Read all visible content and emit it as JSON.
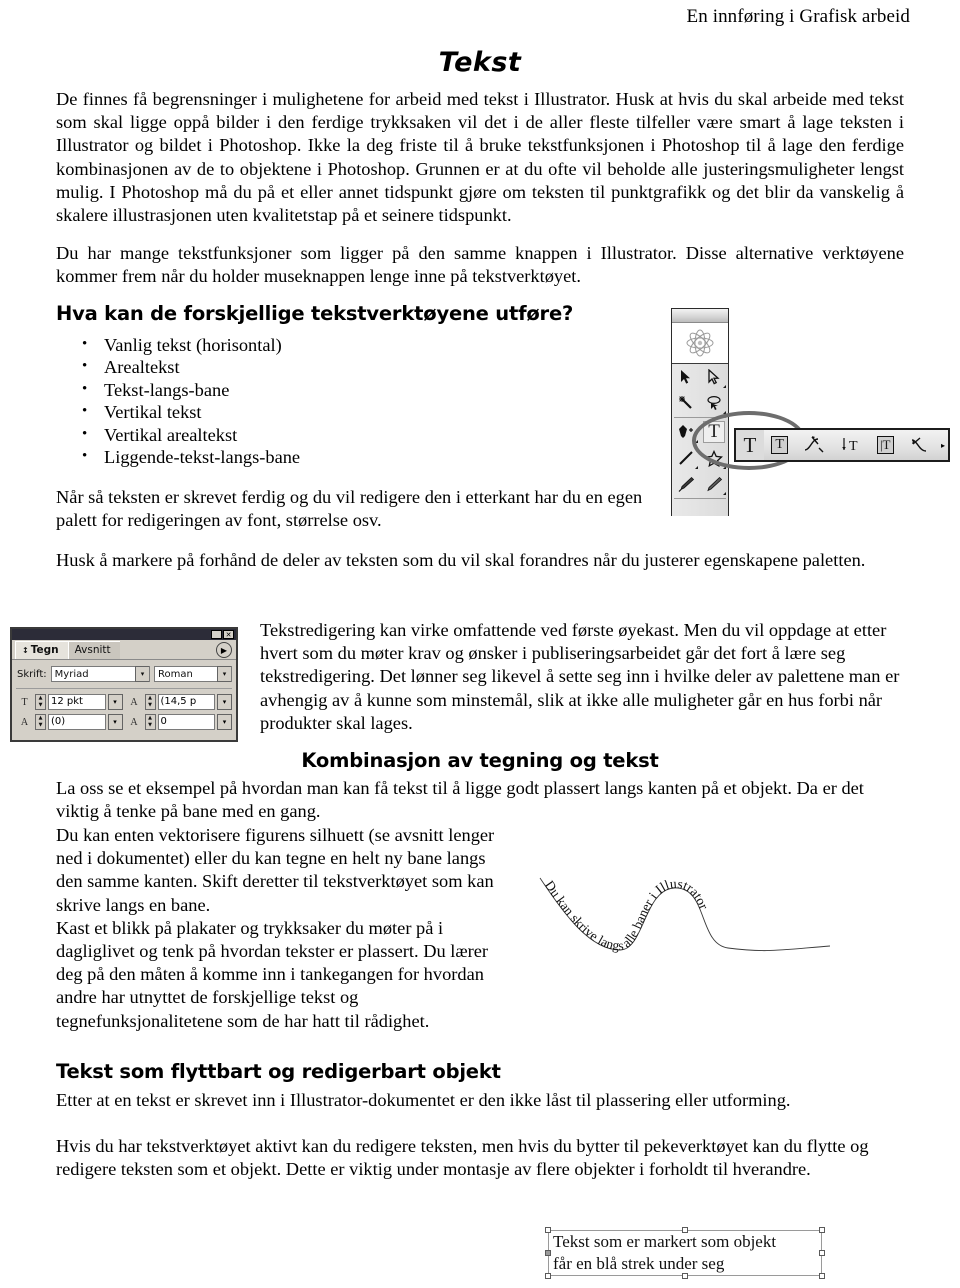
{
  "document": {
    "header": "En innføring i Grafisk arbeid",
    "title": "Tekst"
  },
  "paragraphs": {
    "intro": "De finnes få begrensninger i mulighetene for arbeid med tekst i Illustrator. Husk at hvis du skal arbeide med tekst som skal ligge oppå bilder i den ferdige trykksaken vil det i de aller fleste tilfeller være smart å lage teksten i Illustrator og bildet i Photoshop. Ikke la deg friste til å bruke tekstfunksjonen i Photoshop til å lage den ferdige kombinasjonen av de to objektene i Photoshop. Grunnen er at du ofte vil beholde alle justeringsmuligheter lengst mulig. I Photoshop må du på et eller annet tidspunkt gjøre om teksten til punktgrafikk og det blir da vanskelig å skalere illustrasjonen uten kvalitetstap på et seinere tidspunkt.",
    "many_tools": "Du har mange tekstfunksjoner som ligger på den samme knappen i Illustrator. Disse alternative verktøyene kommer frem når du holder museknappen lenge inne på tekstverktøyet.",
    "after_list": "Når så teksten er skrevet ferdig og du vil redigere den i etterkant har du en egen palett for redigeringen av font, størrelse osv.",
    "mark_first": "Husk å markere på forhånd de deler av teksten som du vil skal forandres når du justerer egenskapene paletten.",
    "editing": "Tekstredigering kan virke omfattende ved første øyekast. Men du vil oppdage at etter hvert som du møter krav og ønsker i publiseringsarbeidet går det fort å lære seg tekstredigering. Det lønner seg likevel å sette seg inn i hvilke deler av palettene man er avhengig av å kunne som minstemål, slik at ikke alle muligheter går en hus forbi når produkter skal lages.",
    "combo_top": "La oss se et eksempel på hvordan man kan få tekst til å ligge godt plassert langs kanten på et objekt. Da er det viktig å tenke på bane med en gang.",
    "combo_left": "Du kan enten vektorisere figurens silhuett (se avsnitt lenger ned i dokumentet) eller du kan tegne en helt ny bane langs den samme kanten. Skift deretter til tekstverktøyet som kan skrive langs en bane.\nKast et blikk på plakater og trykksaker du møter på i dagliglivet og tenk på hvordan tekster er plassert. Du lærer deg på den måten å komme inn i tankegangen for hvordan andre har utnyttet de forskjellige tekst og tegnefunksjonalitetene som de har hatt til rådighet.",
    "movable_1": "Etter at en tekst er skrevet inn i Illustrator-dokumentet er den ikke låst til plassering eller utforming.",
    "movable_2": "Hvis du har tekstverktøyet aktivt kan du redigere teksten, men hvis du bytter til pekeverktøyet kan du flytte og redigere teksten som et objekt. Dette er viktig under montasje av flere objekter i forholdt til hverandre."
  },
  "headings": {
    "what_tools": "Hva kan de forskjellige tekstverktøyene utføre?",
    "combination": "Kombinasjon av tegning og tekst",
    "movable": "Tekst som flyttbart og redigerbart objekt"
  },
  "tool_list": [
    "Vanlig tekst (horisontal)",
    "Arealtekst",
    "Tekst-langs-bane",
    "Vertikal tekst",
    "Vertikal arealtekst",
    "Liggende-tekst-langs-bane"
  ],
  "toolbar_figure": {
    "name": "illustrator-toolbox",
    "tools": [
      "selection-arrow-icon",
      "direct-selection-arrow-icon",
      "magic-wand-icon",
      "lasso-icon",
      "pen-icon",
      "type-tool-icon",
      "line-segment-icon",
      "star-shape-icon",
      "paintbrush-icon",
      "pencil-icon"
    ],
    "selected_tool": "type-tool-icon",
    "flyout": {
      "name": "type-tool-flyout",
      "items": [
        "type-tool-icon",
        "area-type-tool-icon",
        "type-on-path-tool-icon",
        "vertical-type-tool-icon",
        "vertical-area-type-tool-icon",
        "vertical-type-on-path-tool-icon"
      ],
      "selected_index": 0,
      "tear_off_arrow": "▸"
    }
  },
  "character_palette": {
    "window_buttons": {
      "minimize": "_",
      "close": "✕"
    },
    "tabs": [
      {
        "label": "Tegn",
        "active": true
      },
      {
        "label": "Avsnitt",
        "active": false
      }
    ],
    "menu_icon": "▶",
    "font_label": "Skrift:",
    "font_family": "Myriad",
    "font_style": "Roman",
    "size_icon": "T",
    "size_value": "12 pkt",
    "leading_icon": "A",
    "leading_value": "(14,5 p",
    "kerning_icon": "A",
    "kerning_value": "(0)",
    "tracking_icon": "A",
    "tracking_value": "0",
    "dropdown_arrow": "▾",
    "spin_up": "▲",
    "spin_down": "▼"
  },
  "path_text_figure": {
    "name": "text-on-path-illustration",
    "text": "Du kan skrive langs alle baner i Illustrator"
  },
  "selected_object_figure": {
    "name": "selected-text-object",
    "line1": "Tekst som er markert som objekt",
    "line2": "får en blå strek under seg"
  },
  "colors": {
    "text": "#000000",
    "page_background": "#ffffff",
    "palette_face": "#d4d0c8",
    "palette_titlebar": "#2c2c38",
    "highlight_ellipse": "#6d6d6d"
  }
}
